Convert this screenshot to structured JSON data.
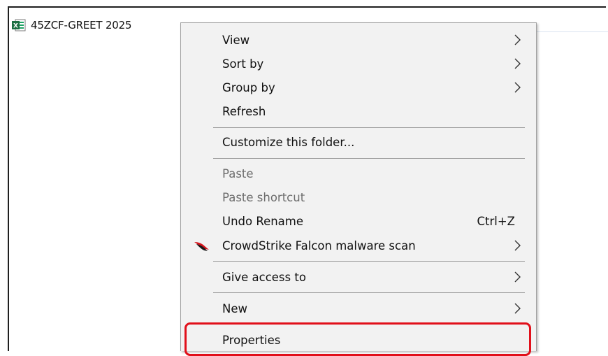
{
  "file": {
    "name": "45ZCF-GREET 2025",
    "icon": "excel-file-icon"
  },
  "context_menu": {
    "items": [
      {
        "label": "View",
        "submenu": true,
        "disabled": false
      },
      {
        "label": "Sort by",
        "submenu": true,
        "disabled": false
      },
      {
        "label": "Group by",
        "submenu": true,
        "disabled": false
      },
      {
        "label": "Refresh",
        "submenu": false,
        "disabled": false
      },
      {
        "label": "Customize this folder...",
        "submenu": false,
        "disabled": false
      },
      {
        "label": "Paste",
        "submenu": false,
        "disabled": true
      },
      {
        "label": "Paste shortcut",
        "submenu": false,
        "disabled": true
      },
      {
        "label": "Undo Rename",
        "shortcut": "Ctrl+Z",
        "submenu": false,
        "disabled": false
      },
      {
        "label": "CrowdStrike Falcon malware scan",
        "submenu": true,
        "disabled": false,
        "icon": "crowdstrike-falcon-icon"
      },
      {
        "label": "Give access to",
        "submenu": true,
        "disabled": false
      },
      {
        "label": "New",
        "submenu": true,
        "disabled": false
      },
      {
        "label": "Properties",
        "submenu": false,
        "disabled": false,
        "highlighted": true
      }
    ]
  },
  "colors": {
    "highlight_border": "#e1101b",
    "menu_background": "#f2f2f2",
    "disabled_text": "#6d6d6d"
  }
}
